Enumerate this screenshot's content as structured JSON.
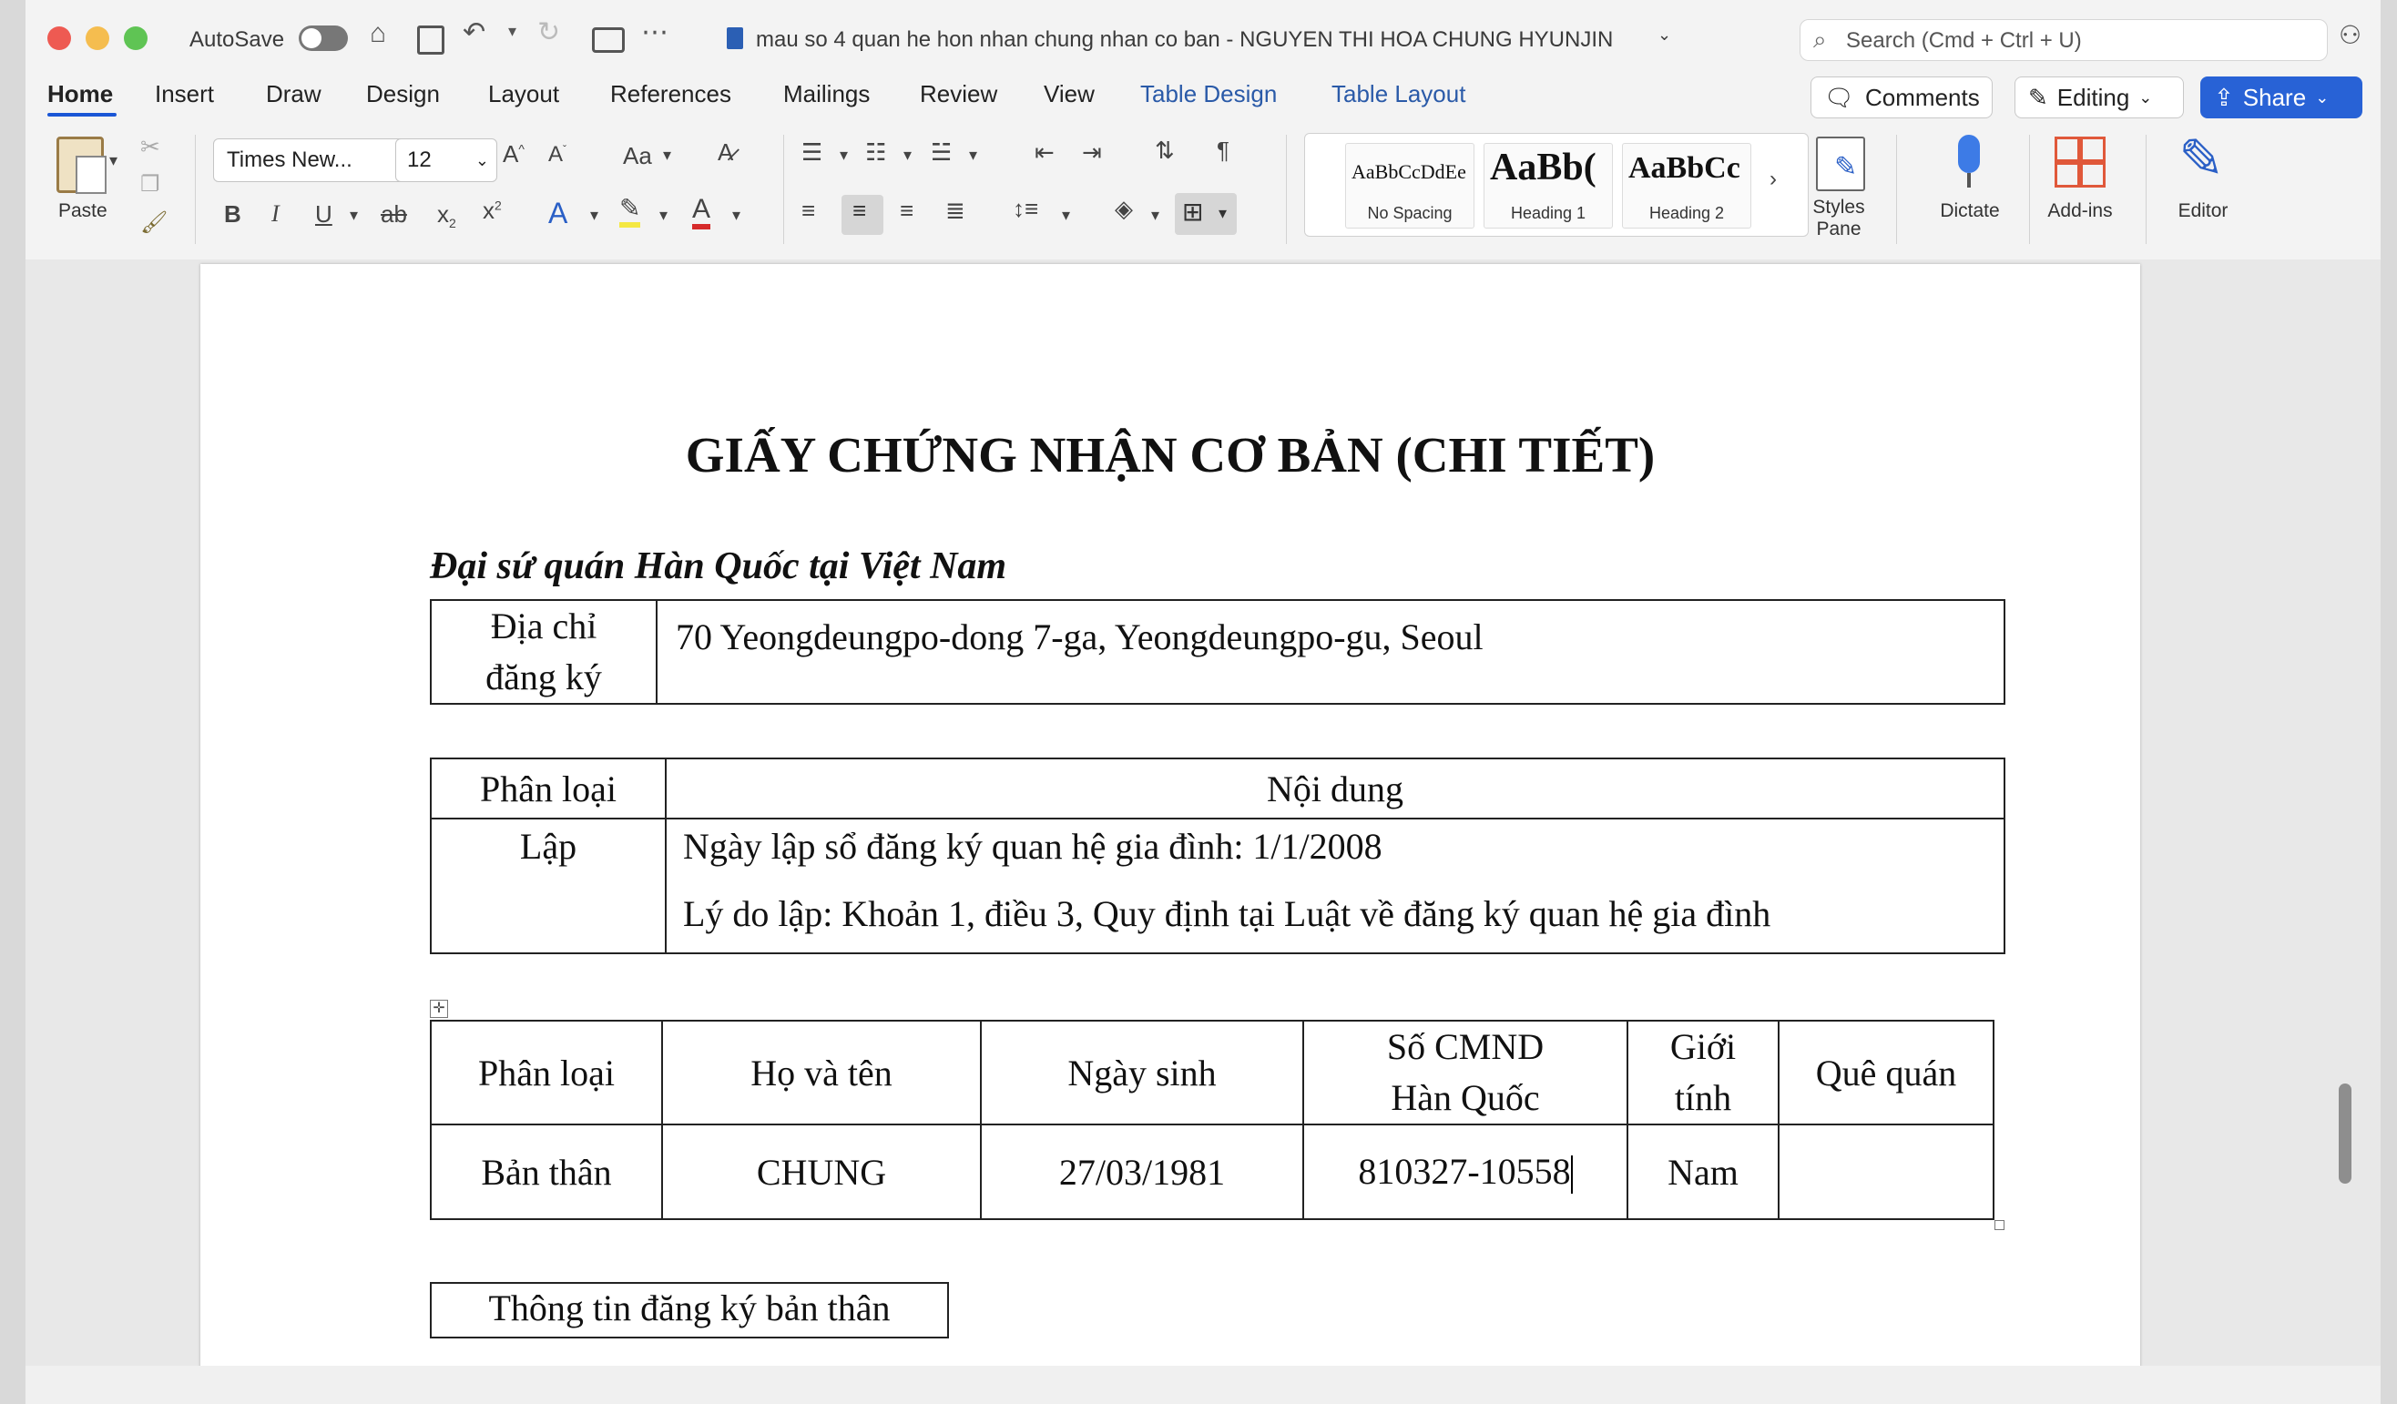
{
  "titlebar": {
    "autosave_label": "AutoSave",
    "document_title": "mau so 4 quan he hon nhan chung nhan co ban  - NGUYEN THI HOA CHUNG HYUNJIN",
    "search_placeholder": "Search (Cmd + Ctrl + U)"
  },
  "tabs": [
    "Home",
    "Insert",
    "Draw",
    "Design",
    "Layout",
    "References",
    "Mailings",
    "Review",
    "View",
    "Table Design",
    "Table Layout"
  ],
  "actions": {
    "comments": "Comments",
    "editing": "Editing",
    "share": "Share"
  },
  "ribbon": {
    "paste_label": "Paste",
    "font_name": "Times New...",
    "font_size": "12",
    "styles": [
      {
        "sample": "AaBbCcDdEe",
        "name": "No Spacing"
      },
      {
        "sample": "AaBb(",
        "name": "Heading 1"
      },
      {
        "sample": "AaBbCc",
        "name": "Heading 2"
      }
    ],
    "styles_pane_label": "Styles\nPane",
    "dictate_label": "Dictate",
    "addins_label": "Add-ins",
    "editor_label": "Editor"
  },
  "document": {
    "title": "GIẤY CHỨNG NHẬN CƠ BẢN (CHI TIẾT)",
    "subtitle": "Đại sứ quán Hàn Quốc tại Việt Nam",
    "address_table": {
      "label": "Địa chỉ\nđăng ký",
      "value": "70 Yeongdeungpo-dong 7-ga, Yeongdeungpo-gu, Seoul"
    },
    "classification_table": {
      "headers": [
        "Phân loại",
        "Nội dung"
      ],
      "row_label": "Lập",
      "lines": [
        "Ngày lập sổ đăng ký quan hệ gia đình: 1/1/2008",
        "Lý do lập: Khoản 1, điều 3, Quy định tại Luật về đăng ký quan hệ gia đình"
      ]
    },
    "person_table": {
      "headers": [
        "Phân loại",
        "Họ và tên",
        "Ngày sinh",
        "Số CMND\nHàn Quốc",
        "Giới\ntính",
        "Quê quán"
      ],
      "row": [
        "Bản thân",
        "CHUNG",
        "27/03/1981",
        "810327-10558",
        "Nam",
        ""
      ]
    },
    "section_box": "Thông tin đăng ký bản thân"
  }
}
